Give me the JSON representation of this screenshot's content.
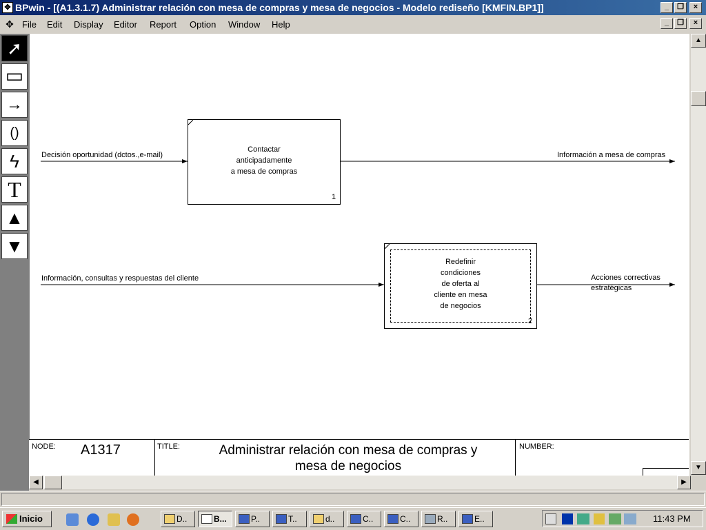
{
  "window": {
    "title": "BPwin - [(A1.3.1.7)  Administrar relación con mesa de compras y mesa de negocios - Modelo rediseño  [KMFIN.BP1]]",
    "minimize": "_",
    "restore": "❐",
    "close": "×"
  },
  "menu": [
    "File",
    "Edit",
    "Display",
    "Editor",
    "Report",
    "Option",
    "Window",
    "Help"
  ],
  "tools": [
    {
      "name": "pointer-tool",
      "glyph": "➚"
    },
    {
      "name": "box-tool",
      "glyph": "▭"
    },
    {
      "name": "arrow-tool",
      "glyph": "→"
    },
    {
      "name": "squiggle-tool",
      "glyph": "()"
    },
    {
      "name": "lightning-tool",
      "glyph": "ϟ"
    },
    {
      "name": "text-tool",
      "glyph": "T"
    },
    {
      "name": "go-up-tool",
      "glyph": "▲"
    },
    {
      "name": "go-down-tool",
      "glyph": "▼"
    }
  ],
  "diagram": {
    "activity1": {
      "text": [
        "Contactar",
        "anticipadamente",
        "a mesa de compras"
      ],
      "number": "1"
    },
    "activity2": {
      "text": [
        "Redefinir",
        "condiciones",
        "de oferta al",
        "cliente en mesa",
        "de negocios"
      ],
      "number": "2"
    },
    "arrows": {
      "in1": "Decisión oportunidad (dctos.,e-mail)",
      "out1": "Información a mesa de compras",
      "in2": "Información, consultas y respuestas del cliente",
      "out2_line1": "Acciones correctivas",
      "out2_line2": "estratégicas"
    }
  },
  "footer": {
    "node_label": "NODE:",
    "node_value": "A1317",
    "title_label": "TITLE:",
    "title_value_line1": "Administrar relación con mesa de compras y",
    "title_value_line2": "mesa de negocios",
    "number_label": "NUMBER:"
  },
  "taskbar": {
    "start": "Inicio",
    "buttons": [
      "D..",
      "B...",
      "P..",
      "T..",
      "d..",
      "C..",
      "C..",
      "R..",
      "E.."
    ],
    "clock": "11:43 PM"
  }
}
